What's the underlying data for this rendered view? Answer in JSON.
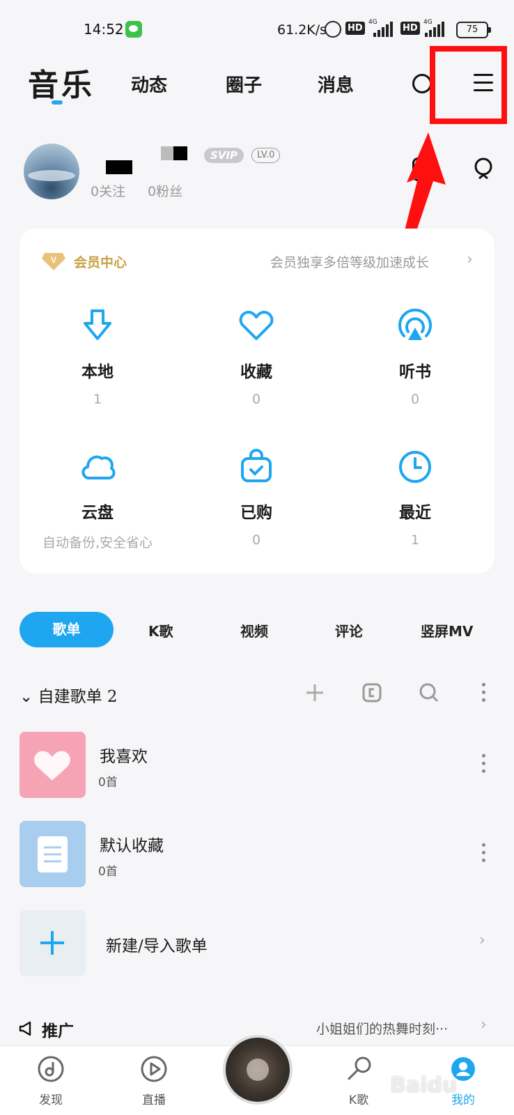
{
  "status_bar": {
    "time": "14:52",
    "net_speed": "61.2K/s",
    "hd1": "HD",
    "hd2": "HD",
    "net1": "4G",
    "net2": "4G",
    "battery": "75"
  },
  "top_nav": {
    "title": "音乐",
    "tabs": [
      "动态",
      "圈子",
      "消息"
    ]
  },
  "profile": {
    "svip": "SVIP",
    "level": "LV.0",
    "follow": "0关注",
    "fans": "0粉丝"
  },
  "vip_card": {
    "title": "会员中心",
    "promo": "会员独享多倍等级加速成长",
    "accent": "#c9a046"
  },
  "grid": [
    {
      "label": "本地",
      "value": "1",
      "icon": "download-icon"
    },
    {
      "label": "收藏",
      "value": "0",
      "icon": "heart-icon"
    },
    {
      "label": "听书",
      "value": "0",
      "icon": "audiobook-icon"
    },
    {
      "label": "云盘",
      "value": "自动备份,安全省心",
      "icon": "cloud-icon"
    },
    {
      "label": "已购",
      "value": "0",
      "icon": "purchased-bag-icon"
    },
    {
      "label": "最近",
      "value": "1",
      "icon": "clock-icon"
    }
  ],
  "tabs": {
    "active": "歌单",
    "items": [
      "K歌",
      "视频",
      "评论",
      "竖屏MV"
    ],
    "accent": "#1ea6f0"
  },
  "playlists": {
    "section_title": "自建歌单 2",
    "rows": [
      {
        "title": "我喜欢",
        "count": "0首"
      },
      {
        "title": "默认收藏",
        "count": "0首"
      },
      {
        "title": "新建/导入歌单"
      }
    ]
  },
  "promo": {
    "title": "推广",
    "text": "小姐姐们的热舞时刻···"
  },
  "bottom_nav": {
    "items": [
      "发现",
      "直播",
      "K歌",
      "我的"
    ]
  },
  "watermark": "Baidu"
}
